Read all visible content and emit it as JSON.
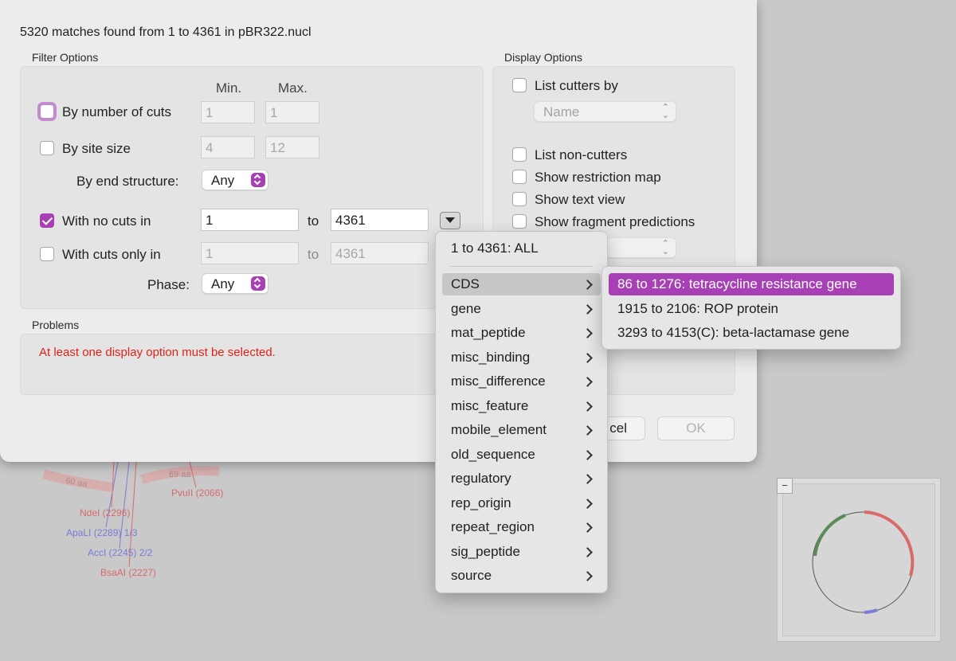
{
  "dialog": {
    "title": "5320 matches found from 1 to 4361 in pBR322.nucl",
    "filter_options": {
      "group_title": "Filter Options",
      "min_header": "Min.",
      "max_header": "Max.",
      "by_number_of_cuts": {
        "label": "By number of cuts",
        "checked": false,
        "min": "1",
        "max": "1"
      },
      "by_site_size": {
        "label": "By site size",
        "checked": false,
        "min": "4",
        "max": "12"
      },
      "by_end_structure": {
        "label": "By end structure:",
        "value": "Any"
      },
      "with_no_cuts_in": {
        "label": "With no cuts in",
        "checked": true,
        "from": "1",
        "to_label": "to",
        "to": "4361"
      },
      "with_cuts_only_in": {
        "label": "With cuts only in",
        "checked": false,
        "from": "1",
        "to_label": "to",
        "to": "4361"
      },
      "phase": {
        "label": "Phase:",
        "value": "Any"
      }
    },
    "display_options": {
      "group_title": "Display Options",
      "list_cutters_by": {
        "label": "List cutters by",
        "checked": false,
        "value": "Name"
      },
      "list_non_cutters": {
        "label": "List non-cutters",
        "checked": false
      },
      "show_restriction_map": {
        "label": "Show restriction map",
        "checked": false
      },
      "show_text_view": {
        "label": "Show text view",
        "checked": false
      },
      "show_fragment_predictions": {
        "label": "Show fragment predictions",
        "checked": false
      }
    },
    "problems": {
      "group_title": "Problems",
      "message": "At least one display option must be selected."
    },
    "buttons": {
      "cancel_partial": "cel",
      "ok": "OK"
    }
  },
  "range_menu": {
    "top_item": "1 to 4361: ALL",
    "items": [
      "CDS",
      "gene",
      "mat_peptide",
      "misc_binding",
      "misc_difference",
      "misc_feature",
      "mobile_element",
      "old_sequence",
      "regulatory",
      "rep_origin",
      "repeat_region",
      "sig_peptide",
      "source"
    ],
    "hovered": "CDS"
  },
  "cds_submenu": {
    "items": [
      "86 to 1276: tetracycline resistance gene",
      "1915 to 2106: ROP protein",
      "3293 to 4153(C): beta-lactamase gene"
    ],
    "selected": "86 to 1276: tetracycline resistance gene"
  },
  "background": {
    "labels": {
      "aa60": "60 aa",
      "aa69": "69 aa",
      "pvuii": "PvuII (2066)",
      "ndei": "NdeI (2296)",
      "apali": "ApaLI (2289) 1/3",
      "accl": "AccI (2245) 2/2",
      "bsaai": "BsaAI (2227)"
    },
    "minimap_button": "−"
  },
  "colors": {
    "accent": "#a640b4",
    "error": "#e32018",
    "map_red": "#d86a6a",
    "map_blue": "#7b7bd8",
    "map_green": "#5a8a5a"
  }
}
